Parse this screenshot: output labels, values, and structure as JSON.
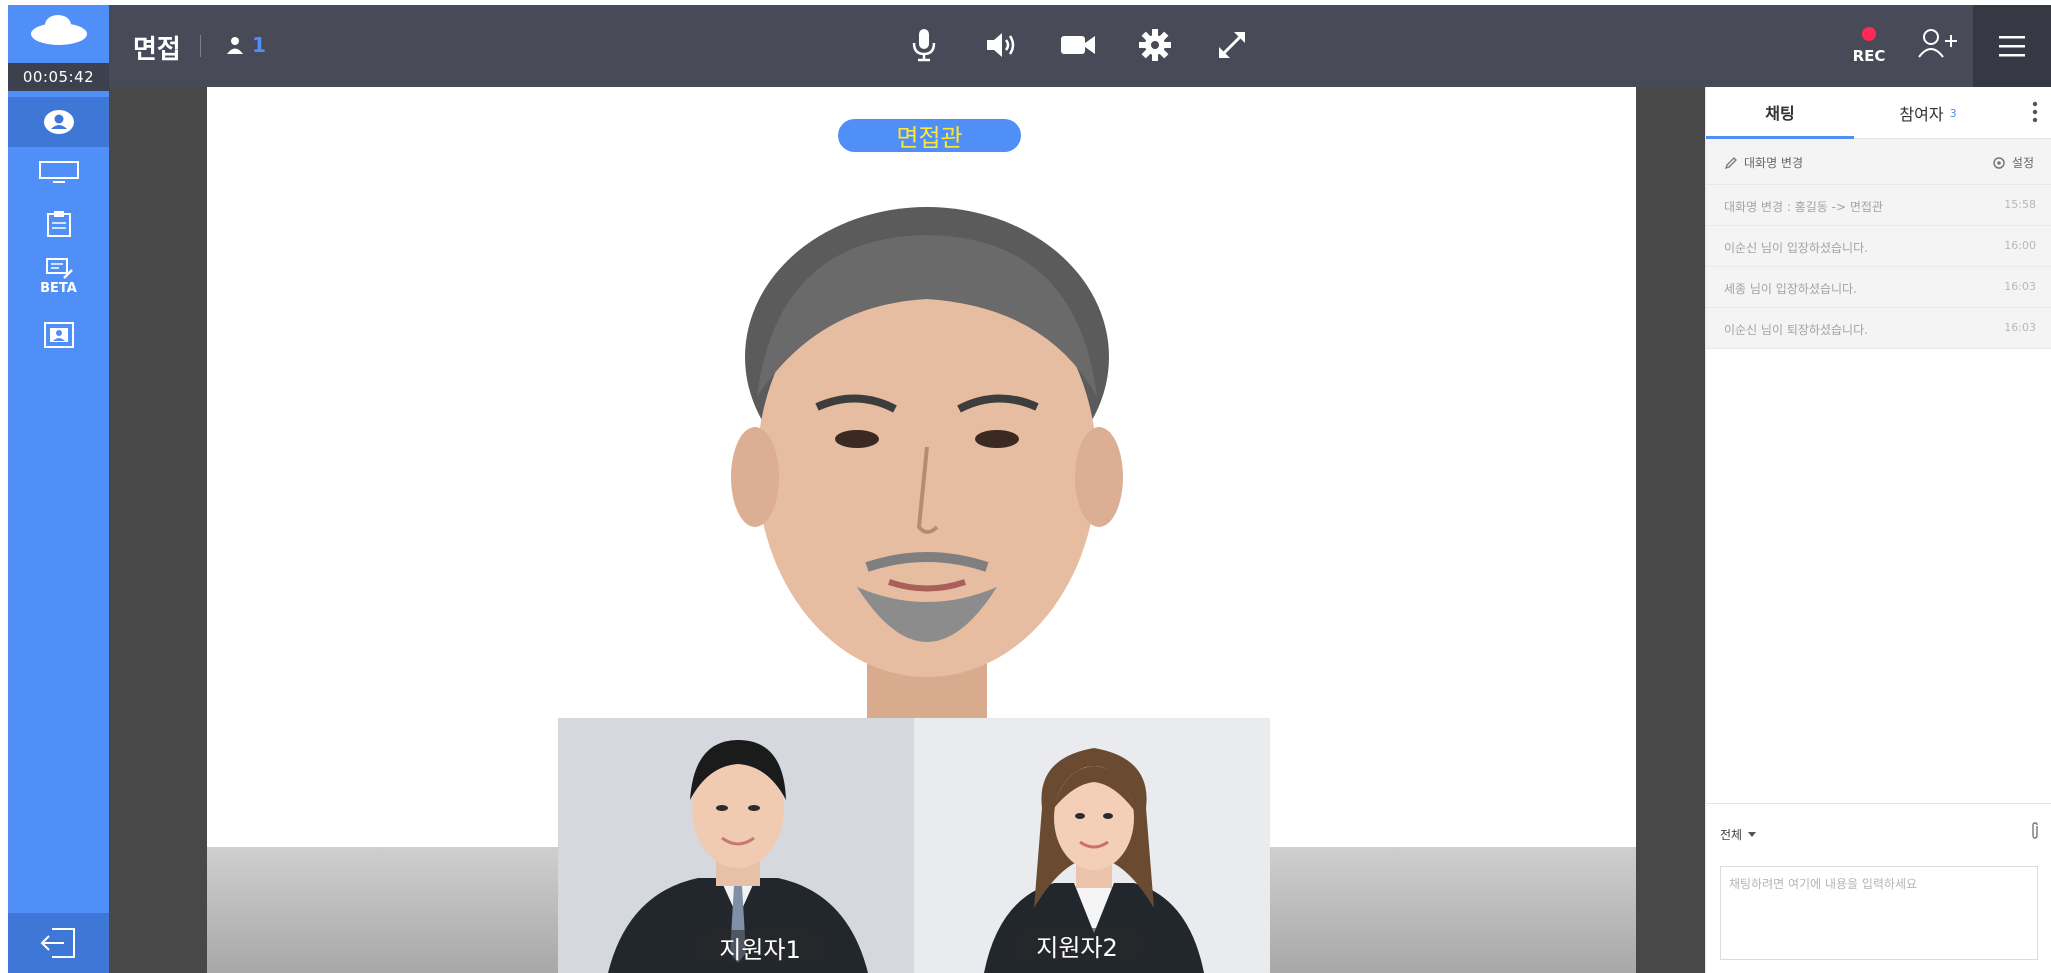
{
  "rail": {
    "timer": "00:05:42",
    "beta_label": "BETA"
  },
  "topbar": {
    "room_title": "면접",
    "participant_count": "1",
    "rec_label": "REC"
  },
  "stage": {
    "main_label": "면접관",
    "thumbnails": [
      {
        "label": "지원자1"
      },
      {
        "label": "지원자2"
      }
    ]
  },
  "panel": {
    "tabs": [
      {
        "label": "채팅"
      },
      {
        "label": "참여자",
        "count": "3"
      }
    ],
    "rename_label": "대화명 변경",
    "settings_label": "설정",
    "messages": [
      {
        "text": "대화명 변경 : 홍길동 -> 면접관",
        "time": "15:58"
      },
      {
        "text": "이순신 님이 입장하셨습니다.",
        "time": "16:00"
      },
      {
        "text": "세종 님이 입장하셨습니다.",
        "time": "16:03"
      },
      {
        "text": "이순신 님이 퇴장하셨습니다.",
        "time": "16:03"
      }
    ],
    "target_label": "전체",
    "input_placeholder": "채팅하려면 여기에 내용을 입력하세요"
  },
  "colors": {
    "accent": "#4f8ff7",
    "topbar": "#484b57",
    "label_text": "#ffe82b",
    "rec": "#ff2a55"
  }
}
